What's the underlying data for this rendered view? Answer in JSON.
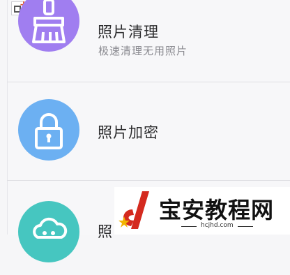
{
  "menu": {
    "items": [
      {
        "title": "照片清理",
        "subtitle": "极速清理无用照片",
        "icon": "broom-icon",
        "color": "#a07ef0"
      },
      {
        "title": "照片加密",
        "icon": "lock-icon",
        "color": "#6cb0f2"
      },
      {
        "title": "照",
        "icon": "cloud-icon",
        "color": "#46c6c0"
      }
    ]
  },
  "watermark": {
    "text": "宝安教程网",
    "url": "hcjhd.com"
  },
  "overlay": {
    "badge_icon": "add-window-icon"
  }
}
